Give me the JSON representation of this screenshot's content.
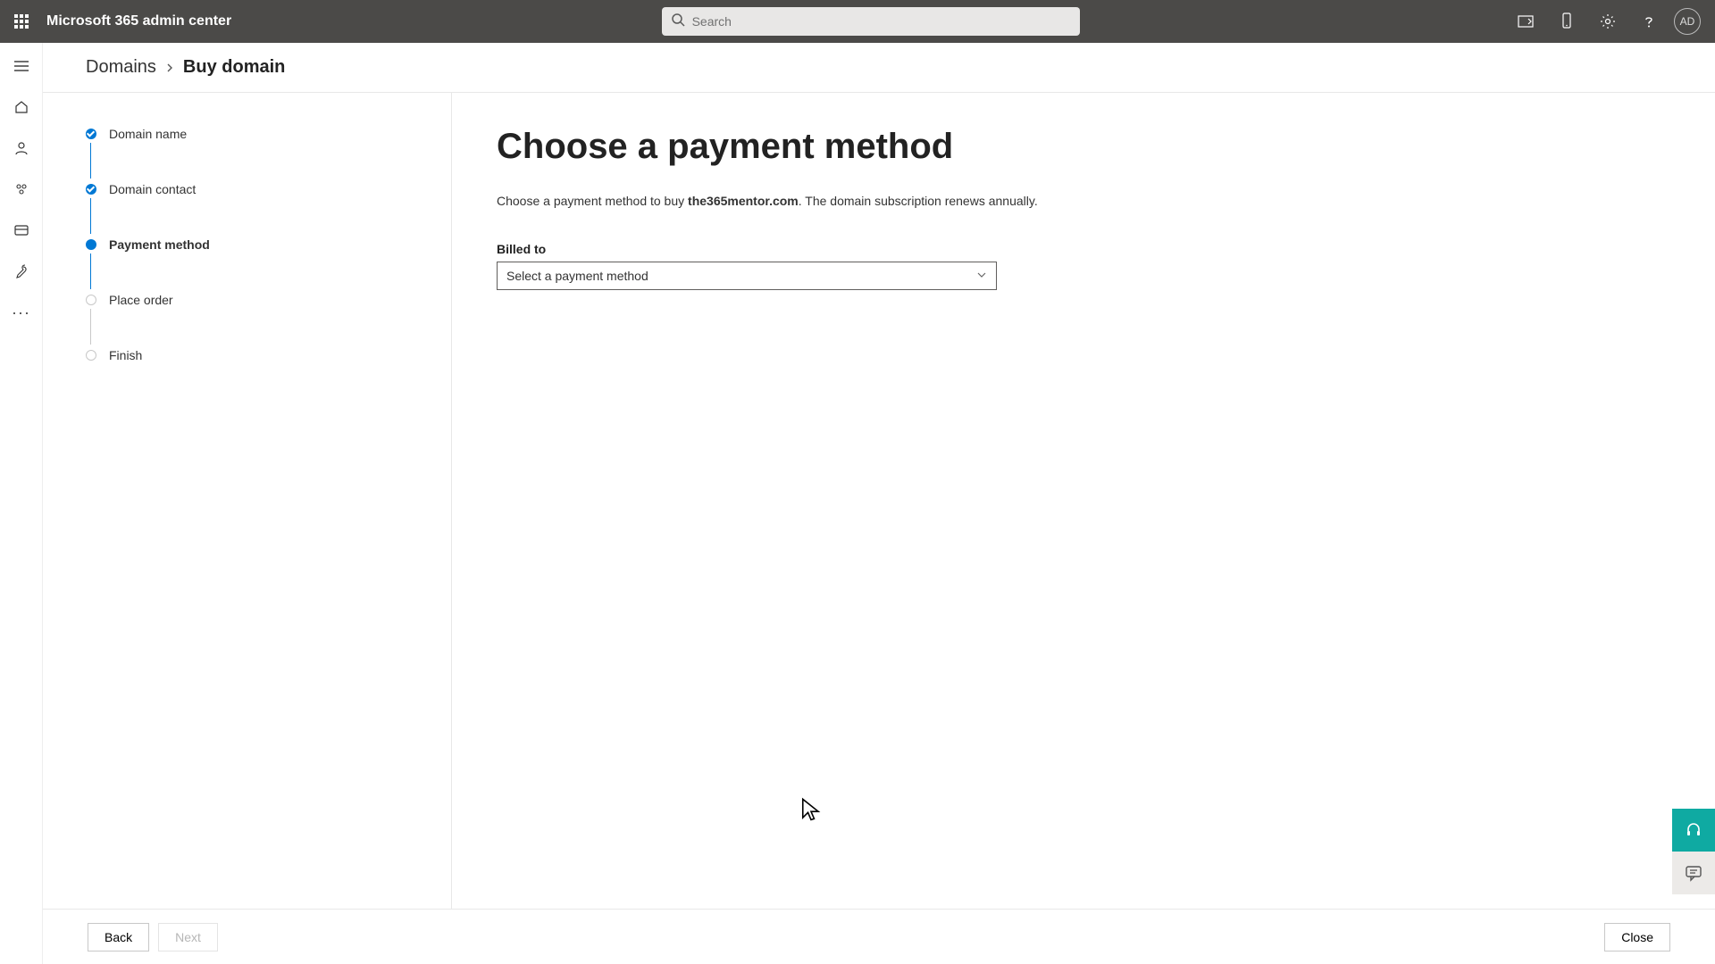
{
  "header": {
    "app_title": "Microsoft 365 admin center",
    "search_placeholder": "Search",
    "avatar_initials": "AD"
  },
  "breadcrumb": {
    "root": "Domains",
    "current": "Buy domain"
  },
  "stepper": {
    "items": [
      {
        "label": "Domain name",
        "state": "completed"
      },
      {
        "label": "Domain contact",
        "state": "completed"
      },
      {
        "label": "Payment method",
        "state": "current"
      },
      {
        "label": "Place order",
        "state": "upcoming"
      },
      {
        "label": "Finish",
        "state": "upcoming"
      }
    ]
  },
  "main": {
    "title": "Choose a payment method",
    "desc_prefix": "Choose a payment method to buy ",
    "desc_domain": "the365mentor.com",
    "desc_suffix": ". The domain subscription renews annually.",
    "billed_to_label": "Billed to",
    "dropdown_placeholder": "Select a payment method"
  },
  "footer": {
    "back_label": "Back",
    "next_label": "Next",
    "close_label": "Close"
  }
}
